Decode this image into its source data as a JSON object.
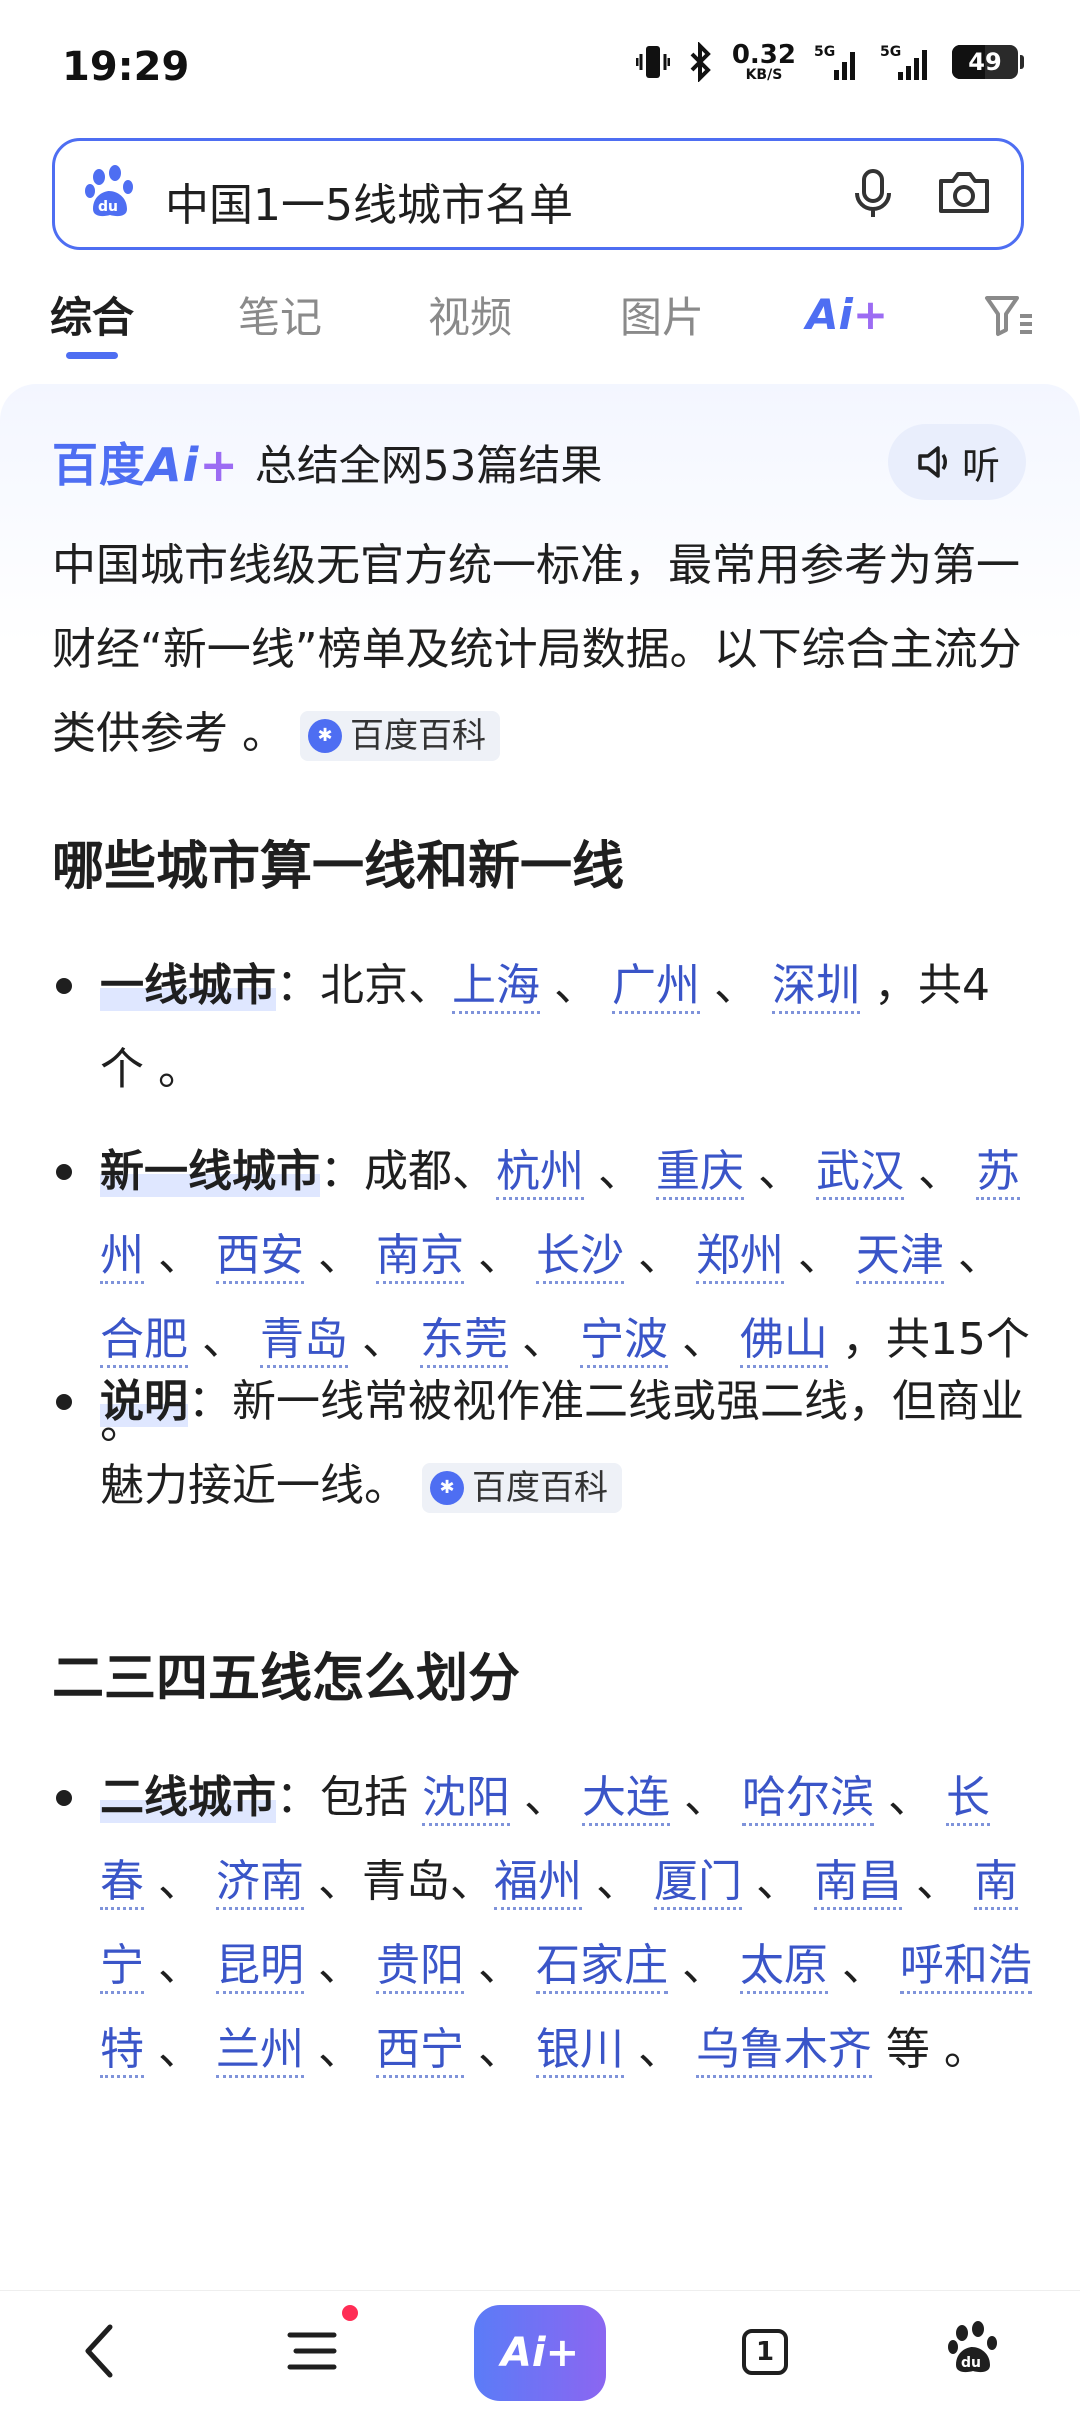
{
  "status": {
    "time": "19:29",
    "net_speed": "0.32",
    "net_unit": "KB/S",
    "signal1": "5G",
    "signal2": "5G",
    "battery": "49"
  },
  "search": {
    "query": "中国1一5线城市名单"
  },
  "tabs": [
    {
      "label": "综合"
    },
    {
      "label": "笔记"
    },
    {
      "label": "视频"
    },
    {
      "label": "图片"
    }
  ],
  "tab_ai": {
    "label": "Ai",
    "plus": "+"
  },
  "ai": {
    "brand": "百度",
    "brand_ai": "Ai",
    "brand_plus": "+",
    "summary": "总结全网53篇结果",
    "listen": "听"
  },
  "intro": {
    "text": "中国城市线级无官方统一标准，最常用参考为第一财经“新一线”榜单及统计局数据。以下综合主流分类供参考 。",
    "source": "百度百科"
  },
  "section1": {
    "title": "哪些城市算一线和新一线",
    "b1": {
      "kw": "一线城市",
      "p1": "：北京、",
      "l1": "上海",
      "s1": " 、 ",
      "l2": "广州",
      "s2": " 、 ",
      "l3": "深圳",
      "end": " ，共4个 。"
    },
    "b2": {
      "kw": "新一线城市",
      "p1": "：成都、",
      "links": [
        "杭州",
        "重庆",
        "武汉",
        "苏州",
        "西安",
        "南京",
        "长沙",
        "郑州",
        "天津",
        "合肥",
        "青岛",
        "东莞",
        "宁波",
        "佛山"
      ],
      "sep": " 、 ",
      "end": " ，共15个 。"
    },
    "b3": {
      "kw": "说明",
      "text": "：新一线常被视作准二线或强二线，但商业魅力接近一线。",
      "source": "百度百科"
    }
  },
  "section2": {
    "title": "二三四五线怎么划分",
    "b1": {
      "kw": "二线城市",
      "p1": "：包括 ",
      "l_a": [
        "沈阳",
        "大连",
        "哈尔滨",
        "长春",
        "济南"
      ],
      "mid": " 、青岛、",
      "l_b": [
        "福州",
        "厦门",
        "南昌",
        "南宁",
        "昆明",
        "贵阳",
        "石家庄",
        "太原",
        "呼和浩特",
        "兰州",
        "西宁",
        "银川",
        "乌鲁木齐"
      ],
      "sep": " 、 ",
      "end": " 等 。"
    }
  },
  "bottom": {
    "ai": "Ai",
    "plus": "+",
    "tab_count": "1"
  }
}
